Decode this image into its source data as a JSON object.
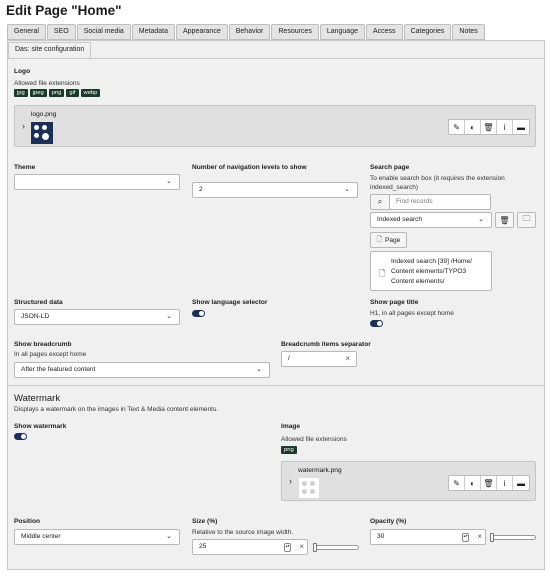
{
  "page": {
    "title": "Edit Page \"Home\""
  },
  "tabs": [
    "General",
    "SEO",
    "Social media",
    "Metadata",
    "Appearance",
    "Behavior",
    "Resources",
    "Language",
    "Access",
    "Categories",
    "Notes"
  ],
  "subtab": "Das: site configuration",
  "logo": {
    "label": "Logo",
    "allowed_label": "Allowed file extensions",
    "extensions": [
      "jpg",
      "jpeg",
      "png",
      "gif",
      "webp"
    ],
    "filename": "logo.png"
  },
  "theme": {
    "label": "Theme",
    "value": ""
  },
  "nav_levels": {
    "label": "Number of navigation levels to show",
    "value": "2"
  },
  "search_page": {
    "label": "Search page",
    "desc1": "To enable search box (it requires the extension",
    "desc2": "indexed_search)",
    "find_placeholder": "Find records",
    "selected": "Indexed search",
    "page_button": "Page",
    "suggestion_lines": [
      "Indexed search [39] /Home/",
      "Content elements/TYPO3",
      "Content elements/"
    ]
  },
  "structured_data": {
    "label": "Structured data",
    "value": "JSON-LD"
  },
  "language_selector": {
    "label": "Show language selector"
  },
  "page_title": {
    "label": "Show page title",
    "desc": "H1, in all pages except home"
  },
  "breadcrumb": {
    "label": "Show breadcrumb",
    "desc": "In all pages except home",
    "value": "After the featured content"
  },
  "breadcrumb_sep": {
    "label": "Breadcrumb items separator",
    "value": "/"
  },
  "watermark": {
    "title": "Watermark",
    "desc": "Displays a watermark on the images in Text & Media content elements.",
    "show_label": "Show watermark",
    "image_label": "Image",
    "allowed_label": "Allowed file extensions",
    "extensions": [
      "png"
    ],
    "filename": "watermark.png"
  },
  "position": {
    "label": "Position",
    "value": "Middle center"
  },
  "size": {
    "label": "Size (%)",
    "desc": "Relative to the source image width.",
    "value": "25"
  },
  "opacity": {
    "label": "Opacity (%)",
    "value": "30"
  },
  "icons": {
    "edit": "pencil-icon",
    "toggle": "toggle-icon",
    "delete": "trash-icon",
    "info": "info-icon",
    "menu": "menu-icon",
    "search": "search-icon",
    "folder": "folder-icon",
    "page": "page-icon",
    "chevron": "chevron-right-icon"
  },
  "colors": {
    "accent": "#1c2f57",
    "badge": "#1a3a2a",
    "panel": "#f0f0f0"
  }
}
